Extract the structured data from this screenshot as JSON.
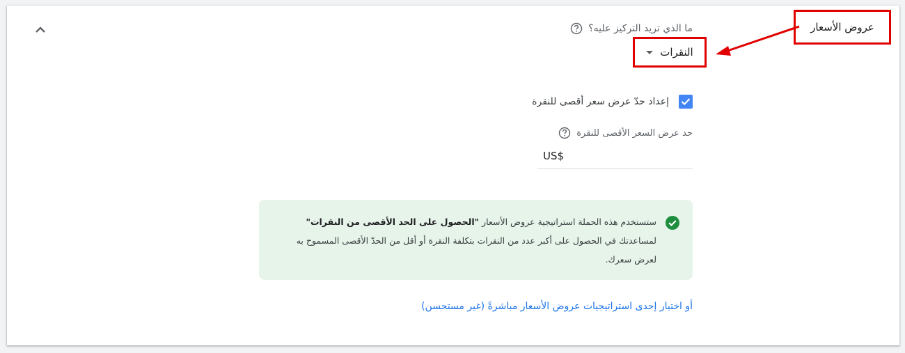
{
  "annotation": {
    "section_label": "عروض الأسعار"
  },
  "focus": {
    "question": "ما الذي تريد التركيز عليه؟",
    "selected_value": "النقرات"
  },
  "max_cpc": {
    "checkbox_label": "إعداد حدّ عرض سعر أقصى للنقرة",
    "checked": true,
    "limit_label": "حد عرض السعر الأقصى للنقرة",
    "currency_value": "US$"
  },
  "info": {
    "text_before": "ستستخدم هذه الحملة استراتيجية عروض الأسعار ",
    "strategy_name": "\"الحصول على الحد الأقصى من النقرات\"",
    "text_after": " لمساعدتك في الحصول على أكبر عدد من النقرات بتكلفة النقرة أو أقل من الحدّ الأقصى المسموح به لعرض سعرك."
  },
  "link": {
    "label": "أو اختيار إحدى استراتيجيات عروض الأسعار مباشرةً (غير مستحسن)"
  },
  "colors": {
    "annotation_red": "#e00000",
    "checkbox_blue": "#4285f4",
    "success_green": "#1e8e3e",
    "info_bg": "#e6f4ea",
    "link_blue": "#1a73e8"
  }
}
